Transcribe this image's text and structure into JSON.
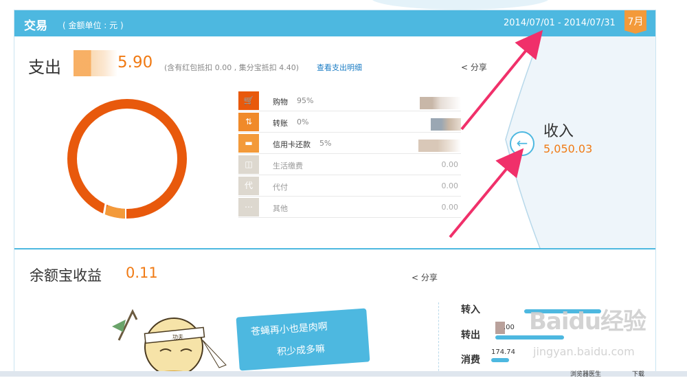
{
  "header": {
    "title": "交易",
    "unit_note": "( 金额单位 : 元 )",
    "date_range": "2014/07/01 - 2014/07/31",
    "month_tab": "7月"
  },
  "expense": {
    "label": "支出",
    "amount_visible": "5.90",
    "note": "(含有红包抵扣 0.00 , 集分宝抵扣 4.40)",
    "detail_link": "查看支出明细",
    "share": "分享",
    "categories": [
      {
        "icon": "cart-icon",
        "name": "购物",
        "pct": "95%",
        "value": "",
        "color": "#e8590c",
        "active": true
      },
      {
        "icon": "transfer-icon",
        "name": "转账",
        "pct": "0%",
        "value": "",
        "color": "#f08a2a",
        "active": true
      },
      {
        "icon": "card-icon",
        "name": "信用卡还款",
        "pct": "5%",
        "value": "",
        "color": "#f39a3a",
        "active": true
      },
      {
        "icon": "bill-icon",
        "name": "生活缴费",
        "pct": "",
        "value": "0.00",
        "color": "#ddd8cf",
        "active": false
      },
      {
        "icon": "pay-icon",
        "name": "代付",
        "pct": "",
        "value": "0.00",
        "color": "#ddd8cf",
        "active": false
      },
      {
        "icon": "more-icon",
        "name": "其他",
        "pct": "",
        "value": "0.00",
        "color": "#ddd8cf",
        "active": false
      }
    ],
    "share_icons": {
      "share": "share-icon"
    },
    "donut_share_main": 0.95,
    "donut_share_minor": 0.05
  },
  "income": {
    "label": "收入",
    "amount": "5,050.03",
    "back_icon": "arrow-left-circle-icon"
  },
  "yuebao": {
    "label": "余额宝收益",
    "amount": "0.11",
    "share": "分享",
    "bubble_line1": "苍蝇再小也是肉啊",
    "bubble_line2": "积少成多嘛",
    "headband_text": "功夫",
    "flows": [
      {
        "label": "转入",
        "value": ""
      },
      {
        "label": "转出",
        "value": ".00"
      },
      {
        "label": "消费",
        "value": "174.74"
      }
    ]
  },
  "watermark": {
    "line1": "Baidu经验",
    "line2": "jingyan.baidu.com"
  },
  "taskbar": {
    "item1": "浏览器医生",
    "item2": "下载"
  },
  "colors": {
    "accent": "#4db8e0",
    "orange": "#f07a14",
    "donut": "#e8590c"
  }
}
